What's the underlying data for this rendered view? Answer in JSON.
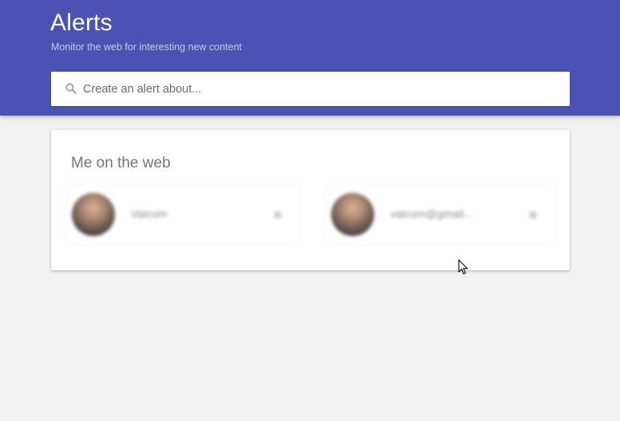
{
  "header": {
    "title": "Alerts",
    "subtitle": "Monitor the web for interesting new content",
    "background_color": "#4a53b4"
  },
  "search": {
    "placeholder": "Create an alert about...",
    "value": "",
    "icon": "search-icon"
  },
  "me_on_the_web": {
    "title": "Me on the web",
    "accounts": [
      {
        "name": "Vaicum",
        "blurred": true,
        "action_icon": "add-icon"
      },
      {
        "name": "vaicum@gmail...",
        "blurred": true,
        "action_icon": "add-icon"
      }
    ]
  }
}
